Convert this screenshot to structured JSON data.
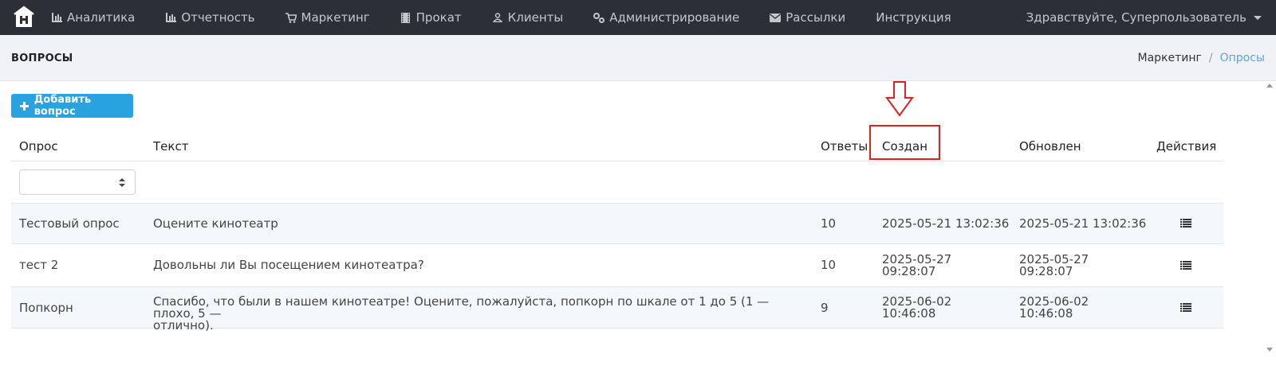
{
  "nav": {
    "logo_icon": "cinema-building-logo",
    "items": [
      {
        "label": "Аналитика",
        "icon": "bar-chart-icon"
      },
      {
        "label": "Отчетность",
        "icon": "bar-chart-icon"
      },
      {
        "label": "Маркетинг",
        "icon": "cart-icon"
      },
      {
        "label": "Прокат",
        "icon": "film-icon"
      },
      {
        "label": "Клиенты",
        "icon": "user-icon"
      },
      {
        "label": "Администрирование",
        "icon": "gears-icon"
      },
      {
        "label": "Рассылки",
        "icon": "envelope-icon"
      },
      {
        "label": "Инструкция",
        "icon": ""
      }
    ],
    "user_greeting": "Здравствуйте, Суперпользователь"
  },
  "header": {
    "title": "ВОПРОСЫ",
    "breadcrumb": [
      "Маркетинг",
      "Опросы"
    ],
    "breadcrumb_separator": "/"
  },
  "toolbar": {
    "add_label": "Добавить вопрос"
  },
  "table": {
    "columns": [
      "Опрос",
      "Текст",
      "Ответы",
      "Создан",
      "Обновлен",
      "Действия"
    ],
    "filter_select_value": "",
    "rows": [
      {
        "survey": "Тестовый опрос",
        "text_lines": [
          "Оцените кинотеатр"
        ],
        "answers": "10",
        "created_lines": [
          "2025-05-21 13:02:36"
        ],
        "updated_lines": [
          "2025-05-21 13:02:36"
        ]
      },
      {
        "survey": "тест 2",
        "text_lines": [
          "Довольны ли Вы посещением кинотеатра?"
        ],
        "answers": "10",
        "created_lines": [
          "2025-05-27",
          "09:28:07"
        ],
        "updated_lines": [
          "2025-05-27",
          "09:28:07"
        ]
      },
      {
        "survey": "Попкорн",
        "text_lines": [
          "Спасибо, что были в нашем кинотеатре! Оцените, пожалуйста, попкорн по шкале от 1 до 5 (1 — плохо, 5 —",
          "отлично)."
        ],
        "answers": "9",
        "created_lines": [
          "2025-06-02",
          "10:46:08"
        ],
        "updated_lines": [
          "2025-06-02",
          "10:46:08"
        ]
      }
    ]
  },
  "colors": {
    "nav_bg": "#2c2f38",
    "accent": "#29a3e0",
    "breadcrumb_active": "#5aa5dc",
    "annotation": "#e02020"
  }
}
